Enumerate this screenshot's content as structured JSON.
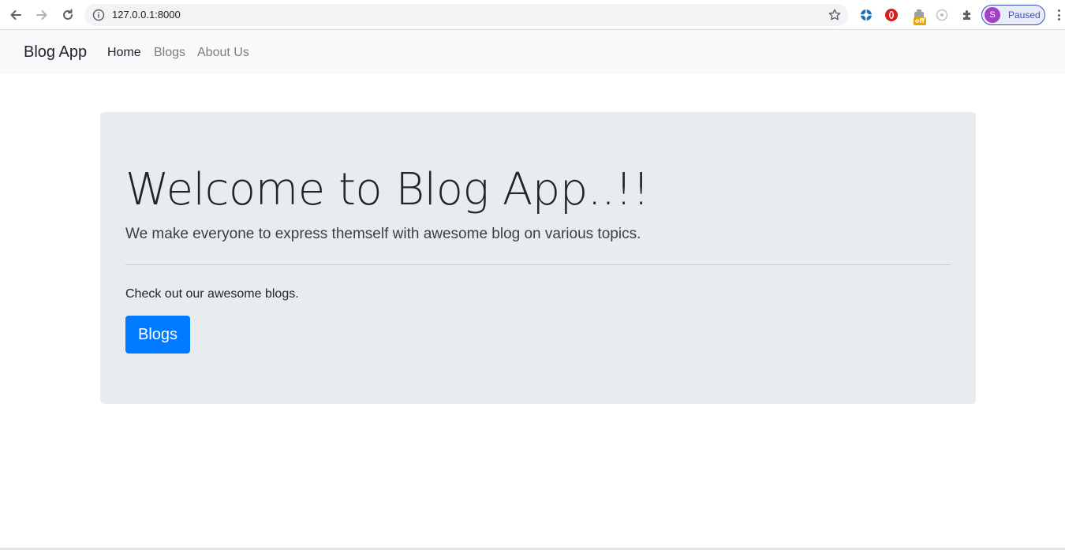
{
  "browser": {
    "url": "127.0.0.1:8000",
    "profile_initial": "S",
    "profile_status": "Paused",
    "extension_badge": "off",
    "icons": [
      "back-icon",
      "forward-icon",
      "reload-icon",
      "info-icon",
      "star-icon",
      "extension-icon",
      "puzzle-icon",
      "menu-icon"
    ]
  },
  "navbar": {
    "brand": "Blog App",
    "links": [
      {
        "label": "Home",
        "active": true
      },
      {
        "label": "Blogs",
        "active": false
      },
      {
        "label": "About Us",
        "active": false
      }
    ]
  },
  "jumbotron": {
    "heading": "Welcome to Blog App..!!",
    "lead": "We make everyone to express themself with awesome blog on various topics.",
    "text": "Check out our awesome blogs.",
    "button_label": "Blogs"
  },
  "colors": {
    "primary": "#007bff",
    "jumbotron_bg": "#e9ecef",
    "navbar_bg": "#f8f9fa"
  }
}
